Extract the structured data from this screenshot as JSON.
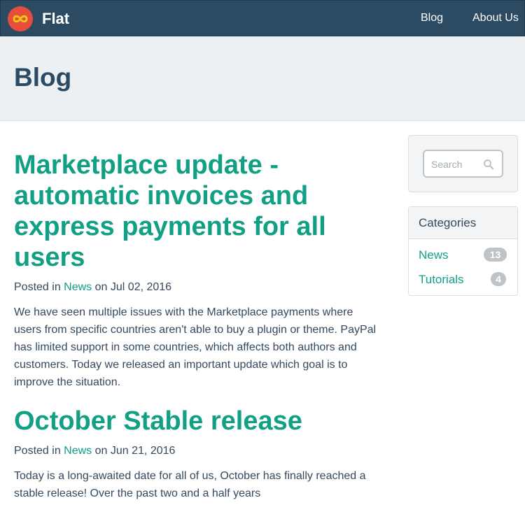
{
  "navbar": {
    "brand": "Flat",
    "links": [
      "Blog",
      "About Us"
    ]
  },
  "page": {
    "title": "Blog"
  },
  "posts": [
    {
      "title": "Marketplace update - automatic invoices and express payments for all users",
      "posted_in": "Posted in",
      "category": "News",
      "on": "on",
      "date": "Jul 02, 2016",
      "excerpt": "We have seen multiple issues with the Marketplace payments where users from specific countries aren't able to buy a plugin or theme. PayPal has limited support in some countries, which affects both authors and customers. Today we released an important update which goal is to improve the situation."
    },
    {
      "title": "October Stable release",
      "posted_in": "Posted in",
      "category": "News",
      "on": "on",
      "date": "Jun 21, 2016",
      "excerpt": "Today is a long-awaited date for all of us, October has finally reached a stable release! Over the past two and a half years"
    }
  ],
  "sidebar": {
    "search": {
      "placeholder": "Search"
    },
    "categories": {
      "heading": "Categories",
      "items": [
        {
          "label": "News",
          "count": "13"
        },
        {
          "label": "Tutorials",
          "count": "4"
        }
      ]
    }
  },
  "colors": {
    "navbar": "#2c4b63",
    "accent": "#12a085",
    "logo": "#e74c3c",
    "badge": "#bdc3c7"
  },
  "icons": [
    "infinity-logo-icon",
    "search-icon"
  ]
}
